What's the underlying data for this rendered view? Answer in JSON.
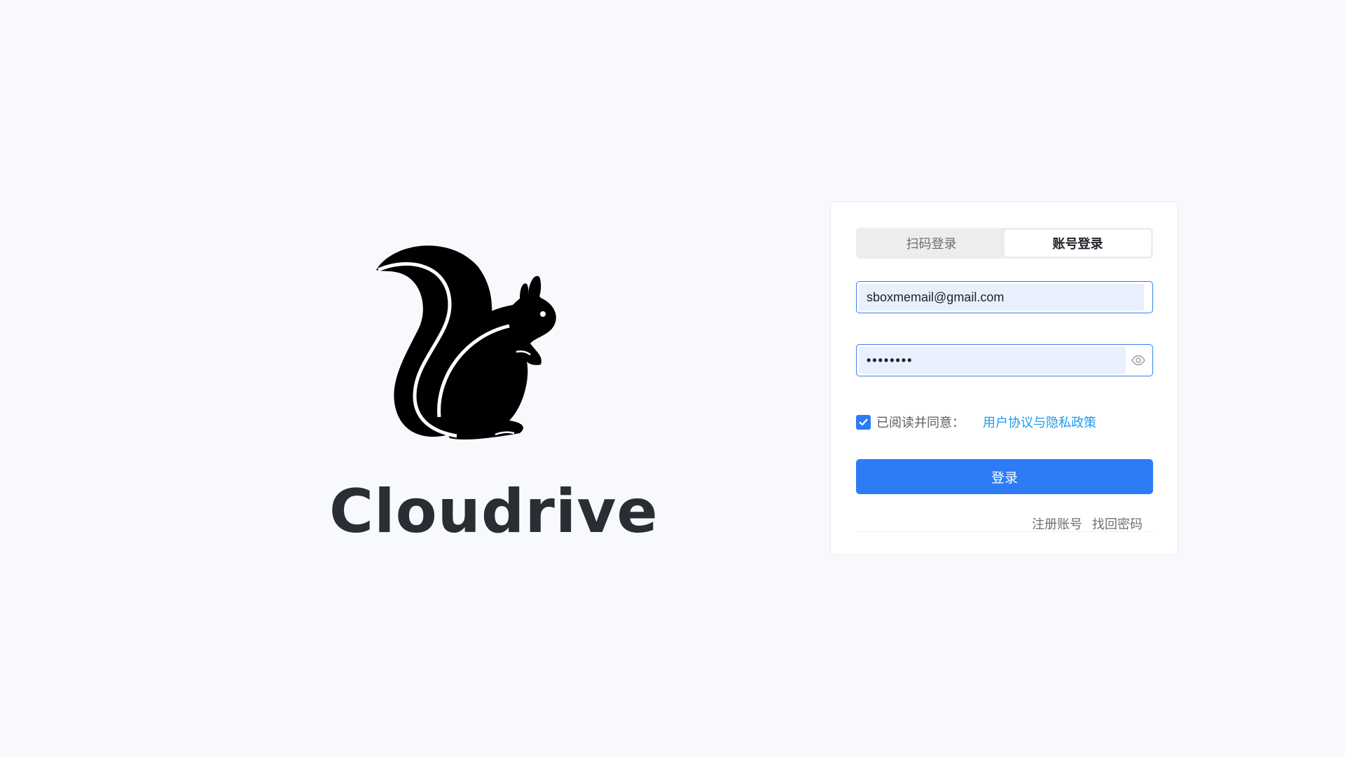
{
  "brand": {
    "name": "Cloudrive",
    "logo_icon": "squirrel-icon"
  },
  "login": {
    "tabs": [
      {
        "label": "扫码登录",
        "active": false
      },
      {
        "label": "账号登录",
        "active": true
      }
    ],
    "email_value": "sboxmemail@gmail.com",
    "password_value": "••••••••",
    "password_toggle_icon": "eye-icon",
    "agree_checked": true,
    "agree_text": "已阅读并同意：",
    "agree_link": "用户协议与隐私政策",
    "submit_label": "登录",
    "register_label": "注册账号",
    "forgot_label": "找回密码"
  },
  "colors": {
    "primary": "#2d7cf6",
    "link": "#1a9af2",
    "background": "#f7f9fc"
  }
}
